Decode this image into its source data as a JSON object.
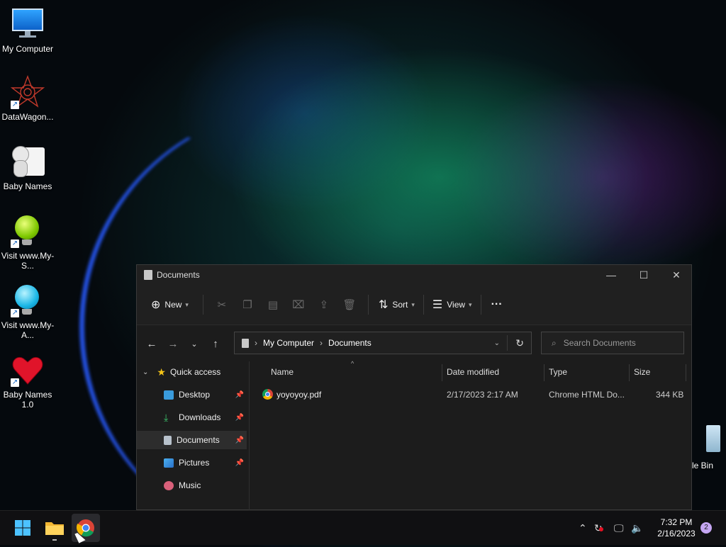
{
  "desktop": {
    "icons": [
      {
        "label": "My Computer"
      },
      {
        "label": "DataWagon..."
      },
      {
        "label": "Baby Names"
      },
      {
        "label": "Visit www.My-S..."
      },
      {
        "label": "Visit www.My-A..."
      },
      {
        "label": "Baby Names 1.0"
      },
      {
        "label": "le Bin"
      }
    ]
  },
  "window": {
    "title": "Documents",
    "toolbar": {
      "new_label": "New",
      "sort_label": "Sort",
      "view_label": "View",
      "more_label": "···"
    },
    "breadcrumb": [
      "My Computer",
      "Documents"
    ],
    "search": {
      "placeholder": "Search Documents"
    },
    "nav": {
      "quick_access": "Quick access",
      "items": [
        {
          "label": "Desktop",
          "pinned": true
        },
        {
          "label": "Downloads",
          "pinned": true
        },
        {
          "label": "Documents",
          "pinned": true
        },
        {
          "label": "Pictures",
          "pinned": true
        },
        {
          "label": "Music",
          "pinned": false
        }
      ]
    },
    "columns": {
      "name": "Name",
      "date": "Date modified",
      "type": "Type",
      "size": "Size"
    },
    "files": [
      {
        "name": "yoyoyoy.pdf",
        "date": "2/17/2023 2:17 AM",
        "type": "Chrome HTML Do...",
        "size": "344 KB"
      }
    ]
  },
  "taskbar": {
    "time": "7:32 PM",
    "date": "2/16/2023",
    "notifications": "2"
  },
  "colors": {
    "accent": "#0078d4",
    "window_bg": "#1c1c1c",
    "taskbar_bg": "#101012"
  }
}
